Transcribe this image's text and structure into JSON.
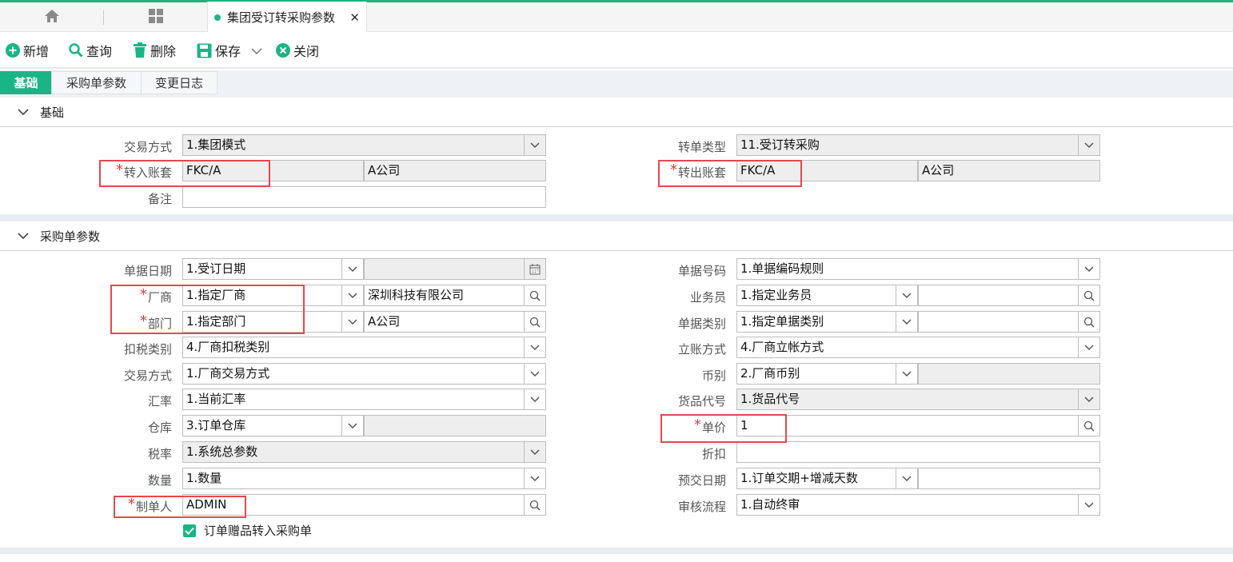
{
  "tabbar": {
    "doc_tab_title": "集团受订转采购参数",
    "close_glyph": "✕"
  },
  "toolbar": {
    "add": "新增",
    "query": "查询",
    "delete": "删除",
    "save": "保存",
    "close": "关闭"
  },
  "subtabs": [
    "基础",
    "采购单参数",
    "变更日志"
  ],
  "sections": {
    "basic": "基础",
    "purchase": "采购单参数"
  },
  "basic": {
    "trade_mode": {
      "label": "交易方式",
      "value": "1.集团模式"
    },
    "transfer_type": {
      "label": "转单类型",
      "value": "11.受订转采购"
    },
    "in_account": {
      "label": "转入账套",
      "code": "FKC/A",
      "name": "A公司"
    },
    "out_account": {
      "label": "转出账套",
      "code": "FKC/A",
      "name": "A公司"
    },
    "remark": {
      "label": "备注",
      "value": ""
    }
  },
  "purchase": {
    "doc_date": {
      "label": "单据日期",
      "value": "1.受订日期",
      "extra": ""
    },
    "doc_no": {
      "label": "单据号码",
      "value": "1.单据编码规则"
    },
    "vendor": {
      "label": "厂商",
      "value": "1.指定厂商",
      "extra": "深圳科技有限公司"
    },
    "salesman": {
      "label": "业务员",
      "value": "1.指定业务员",
      "extra": ""
    },
    "dept": {
      "label": "部门",
      "value": "1.指定部门",
      "extra": "A公司"
    },
    "doc_category": {
      "label": "单据类别",
      "value": "1.指定单据类别",
      "extra": ""
    },
    "tax_deduct": {
      "label": "扣税类别",
      "value": "4.厂商扣税类别"
    },
    "account_mode": {
      "label": "立账方式",
      "value": "4.厂商立帐方式"
    },
    "trade_mode": {
      "label": "交易方式",
      "value": "1.厂商交易方式"
    },
    "currency": {
      "label": "币别",
      "value": "2.厂商币别",
      "extra": ""
    },
    "rate": {
      "label": "汇率",
      "value": "1.当前汇率"
    },
    "goods_code": {
      "label": "货品代号",
      "value": "1.货品代号"
    },
    "warehouse": {
      "label": "仓库",
      "value": "3.订单仓库",
      "extra": ""
    },
    "unit_price": {
      "label": "单价",
      "value": "1"
    },
    "tax_rate": {
      "label": "税率",
      "value": "1.系统总参数"
    },
    "discount": {
      "label": "折扣",
      "value": ""
    },
    "quantity": {
      "label": "数量",
      "value": "1.数量"
    },
    "pre_date": {
      "label": "预交日期",
      "value": "1.订单交期+增减天数",
      "extra": ""
    },
    "maker": {
      "label": "制单人",
      "value": "ADMIN"
    },
    "approval": {
      "label": "审核流程",
      "value": "1.自动终审"
    },
    "gift_checkbox": {
      "label": "订单赠品转入采购单",
      "checked": true
    }
  },
  "required_mark": "*",
  "colors": {
    "accent": "#1ab584",
    "tab_top": "#20b37e",
    "required": "#e23b3b",
    "highlight": "#e5484d"
  }
}
